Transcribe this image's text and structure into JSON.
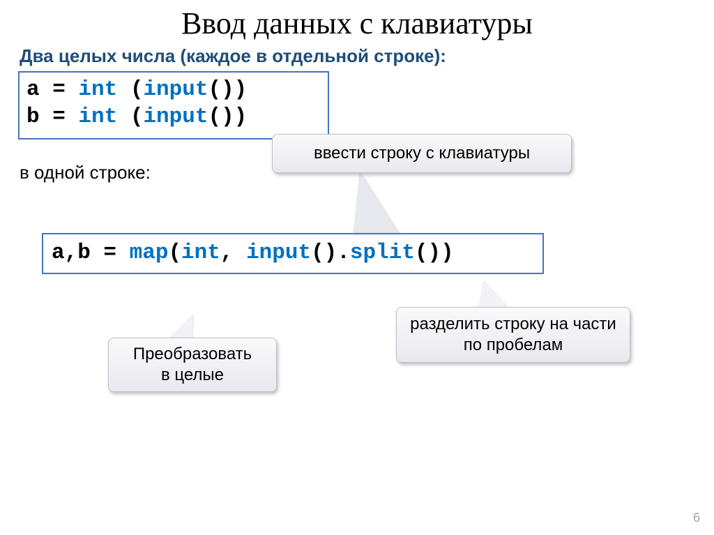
{
  "title": "Ввод данных с клавиатуры",
  "subheading": "Два целых числа (каждое в отдельной строке):",
  "code1": {
    "line1_pre": "a = ",
    "line1_kw1": "int",
    "line1_mid": " (",
    "line1_kw2": "input",
    "line1_post": "())",
    "line2_pre": "b = ",
    "line2_kw1": "int",
    "line2_mid": " (",
    "line2_kw2": "input",
    "line2_post": "())"
  },
  "one_line_label": "в одной строке:",
  "callout_top": "ввести строку с клавиатуры",
  "code2": {
    "pre": "a,b = ",
    "kw_map": "map",
    "open": "(",
    "kw_int": "int",
    "comma": ", ",
    "kw_input": "input",
    "mid": "().",
    "kw_split": "split",
    "post": "())"
  },
  "callout_left": "Преобразовать в целые",
  "callout_right": "разделить строку на части по пробелам",
  "page_number": "6"
}
